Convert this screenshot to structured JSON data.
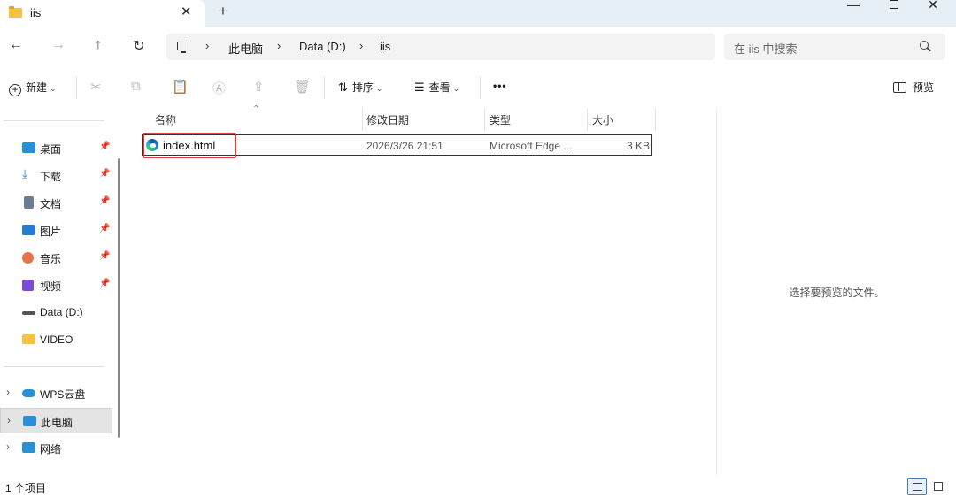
{
  "window": {
    "tab_title": "iis",
    "tab_close": "✕",
    "new_tab": "+",
    "minimize": "—",
    "close": "✕"
  },
  "nav": {
    "back": "←",
    "forward": "→",
    "up": "↑",
    "refresh": "↻"
  },
  "address": {
    "crumbs": [
      "此电脑",
      "Data (D:)",
      "iis"
    ],
    "separator": "›"
  },
  "search": {
    "placeholder": "在 iis 中搜索"
  },
  "toolbar": {
    "new_label": "新建",
    "sort_label": "排序",
    "view_label": "查看",
    "more": "•••",
    "preview_label": "预览",
    "icons": [
      "cut-icon",
      "copy-icon",
      "paste-icon",
      "rename-icon",
      "share-icon",
      "delete-icon"
    ]
  },
  "sidebar": {
    "quick_access": [
      {
        "label": "桌面",
        "icon": "desktop-icon",
        "color": "#2b8fd6",
        "pinned": true
      },
      {
        "label": "下载",
        "icon": "download-icon",
        "color": "#2b8fd6",
        "pinned": true
      },
      {
        "label": "文档",
        "icon": "documents-icon",
        "color": "#6b7c93",
        "pinned": true
      },
      {
        "label": "图片",
        "icon": "pictures-icon",
        "color": "#2a7bd0",
        "pinned": true
      },
      {
        "label": "音乐",
        "icon": "music-icon",
        "color": "#e8734a",
        "pinned": true
      },
      {
        "label": "视频",
        "icon": "videos-icon",
        "color": "#7a4bd6",
        "pinned": true
      },
      {
        "label": "Data (D:)",
        "icon": "drive-icon",
        "color": "#555555",
        "pinned": false
      },
      {
        "label": "VIDEO",
        "icon": "folder-icon",
        "color": "#f5c242",
        "pinned": false
      }
    ],
    "roots": [
      {
        "label": "WPS云盘",
        "icon": "cloud-icon",
        "color": "#2b8fd6"
      },
      {
        "label": "此电脑",
        "icon": "this-pc-icon",
        "color": "#2b8fd6"
      },
      {
        "label": "网络",
        "icon": "network-icon",
        "color": "#2b8fd6"
      }
    ],
    "pin_glyph": "📌",
    "expand_glyph": "›"
  },
  "files": {
    "columns": {
      "name": "名称",
      "modified": "修改日期",
      "type": "类型",
      "size": "大小"
    },
    "sort_glyph": "⌃",
    "rows": [
      {
        "name": "index.html",
        "modified": "2026/3/26 21:51",
        "type": "Microsoft Edge ...",
        "size": "3 KB"
      }
    ]
  },
  "preview": {
    "message": "选择要预览的文件。"
  },
  "status": {
    "item_count": "1 个项目"
  },
  "colors": {
    "titlebar_bg": "#e6eef6",
    "highlight_box": "#e03c3c",
    "selected_view": "#3a7bd5"
  }
}
